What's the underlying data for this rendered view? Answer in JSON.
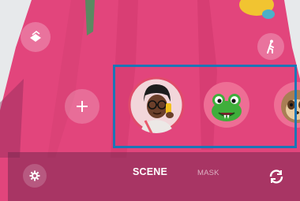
{
  "colors": {
    "background": "#e7e9eb",
    "dress": "#e2457c",
    "selection_highlight": "#1c76b6",
    "selected_ring": "#e04b6b",
    "frog_green": "#3fae3b"
  },
  "top_controls": {
    "filter_icon": "filter-icon",
    "person_icon": "walking-person-icon"
  },
  "add_button": {
    "icon": "plus-icon"
  },
  "avatars": [
    {
      "name": "avatar-self",
      "selected": true
    },
    {
      "name": "avatar-frog",
      "selected": false
    },
    {
      "name": "avatar-sloth",
      "selected": false
    }
  ],
  "bottom_bar": {
    "settings_icon": "gear-icon",
    "tabs": [
      {
        "label": "SCENE",
        "active": true
      },
      {
        "label": "MASK",
        "active": false
      }
    ],
    "switch_camera_icon": "switch-camera-icon"
  }
}
